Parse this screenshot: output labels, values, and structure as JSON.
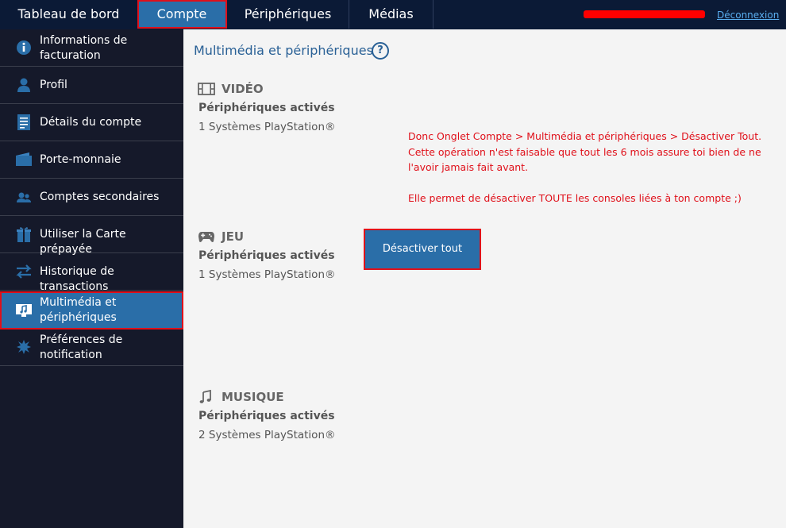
{
  "topnav": {
    "tabs": [
      {
        "label": "Tableau de bord"
      },
      {
        "label": "Compte"
      },
      {
        "label": "Périphériques"
      },
      {
        "label": "Médias"
      }
    ],
    "logout": "Déconnexion"
  },
  "sidebar": {
    "items": [
      {
        "label": "Informations de facturation",
        "icon": "info-icon"
      },
      {
        "label": "Profil",
        "icon": "user-icon"
      },
      {
        "label": "Détails du compte",
        "icon": "document-icon"
      },
      {
        "label": "Porte-monnaie",
        "icon": "wallet-icon"
      },
      {
        "label": "Comptes secondaires",
        "icon": "users-icon"
      },
      {
        "label": "Utiliser la Carte prépayée",
        "icon": "gift-icon"
      },
      {
        "label": "Historique de transactions",
        "icon": "transfer-icon"
      },
      {
        "label": "Multimédia et périphériques",
        "icon": "media-icon"
      },
      {
        "label": "Préférences de notification",
        "icon": "notification-icon"
      }
    ]
  },
  "main": {
    "title": "Multimédia et périphériques",
    "help": "?",
    "sections": [
      {
        "title": "VIDÉO",
        "icon": "film-icon",
        "label": "Périphériques activés",
        "count": "1 Systèmes PlayStation®"
      },
      {
        "title": "JEU",
        "icon": "gamepad-icon",
        "label": "Périphériques activés",
        "count": "1 Systèmes PlayStation®"
      },
      {
        "title": "MUSIQUE",
        "icon": "music-note-icon",
        "label": "Périphériques activés",
        "count": "2 Systèmes PlayStation®"
      }
    ],
    "deactivate_button": "Désactiver tout",
    "annotation": {
      "line1": "Donc Onglet Compte > Multimédia et périphériques > Désactiver Tout.",
      "line2": "Cette opération n'est faisable que tout les 6 mois assure toi bien de ne",
      "line3": "l'avoir jamais fait avant.",
      "line4": "Elle permet de désactiver TOUTE les consoles liées à ton compte ;)"
    }
  },
  "colors": {
    "nav_bg": "#0b1a36",
    "sidebar_bg": "#15192a",
    "accent": "#2a6ea8",
    "highlight": "#e0101a"
  }
}
